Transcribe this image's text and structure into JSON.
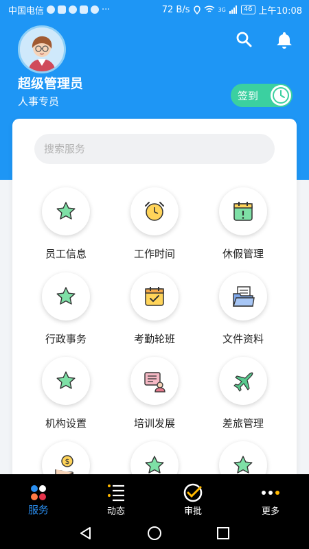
{
  "status_bar": {
    "carrier": "中国电信",
    "more": "···",
    "speed": "72 B/s",
    "network": "3G",
    "battery": "46",
    "time": "上午10:08"
  },
  "header": {
    "user_name": "超级管理员",
    "user_role": "人事专员",
    "checkin_label": "签到",
    "colors": {
      "background": "#1e96f5",
      "checkin": "#3bd0a0"
    }
  },
  "search": {
    "placeholder": "搜索服务"
  },
  "services": [
    {
      "label": "员工信息",
      "icon": "star-icon"
    },
    {
      "label": "工作时间",
      "icon": "alarm-clock-icon"
    },
    {
      "label": "休假管理",
      "icon": "calendar-alert-icon"
    },
    {
      "label": "行政事务",
      "icon": "star-icon"
    },
    {
      "label": "考勤轮班",
      "icon": "calendar-check-icon"
    },
    {
      "label": "文件资料",
      "icon": "folder-icon"
    },
    {
      "label": "机构设置",
      "icon": "star-icon"
    },
    {
      "label": "培训发展",
      "icon": "training-icon"
    },
    {
      "label": "差旅管理",
      "icon": "airplane-icon"
    },
    {
      "label": "",
      "icon": "money-hand-icon"
    },
    {
      "label": "",
      "icon": "star-icon"
    },
    {
      "label": "",
      "icon": "star-icon"
    }
  ],
  "bottom_nav": [
    {
      "label": "服务",
      "icon": "services-dots-icon",
      "active": true
    },
    {
      "label": "动态",
      "icon": "feed-list-icon",
      "active": false
    },
    {
      "label": "审批",
      "icon": "approval-check-icon",
      "active": false
    },
    {
      "label": "更多",
      "icon": "more-dots-icon",
      "active": false
    }
  ],
  "accent_color": "#2a8ef0"
}
